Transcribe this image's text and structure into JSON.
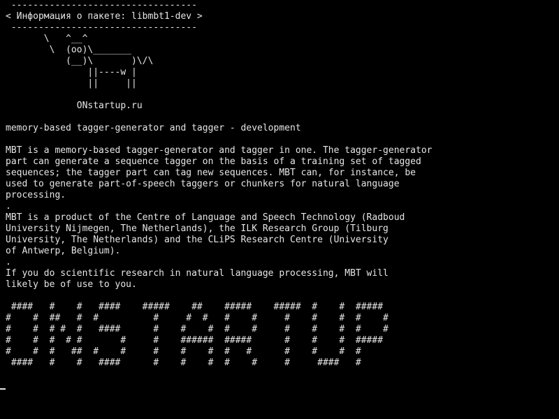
{
  "terminal": {
    "lines": [
      " ----------------------------------",
      "< Информация о пакете: libmbt1-dev >",
      " ----------------------------------",
      "       \\   ^__^",
      "        \\  (oo)\\_______",
      "           (__)\\       )\\/\\",
      "               ||----w |",
      "               ||     ||",
      "",
      "             ONstartup.ru",
      "",
      "memory-based tagger-generator and tagger - development",
      "",
      "MBT is a memory-based tagger-generator and tagger in one. The tagger-generator",
      "part can generate a sequence tagger on the basis of a training set of tagged",
      "sequences; the tagger part can tag new sequences. MBT can, for instance, be",
      "used to generate part-of-speech taggers or chunkers for natural language",
      "processing.",
      ".",
      "MBT is a product of the Centre of Language and Speech Technology (Radboud",
      "University Nijmegen, The Netherlands), the ILK Research Group (Tilburg",
      "University, The Netherlands) and the CLiPS Research Centre (University",
      "of Antwerp, Belgium).",
      ".",
      "If you do scientific research in natural language processing, MBT will",
      "likely be of use to you.",
      "",
      " ####   #    #   ####    #####    ##    #####    #####  #    #  #####",
      "#    #  ##   #  #          #     #  #   #    #     #    #    #  #    #",
      "#    #  # #  #   ####      #    #    #  #    #     #    #    #  #    #",
      "#    #  #  # #       #     #    ######  #####      #    #    #  #####",
      "#    #  #   ##  #    #     #    #    #  #   #      #    #    #  #",
      " ####   #    #   ####      #    #    #  #    #     #     ####   #"
    ]
  },
  "colors": {
    "background": "#000000",
    "foreground": "#e6e6e6"
  }
}
